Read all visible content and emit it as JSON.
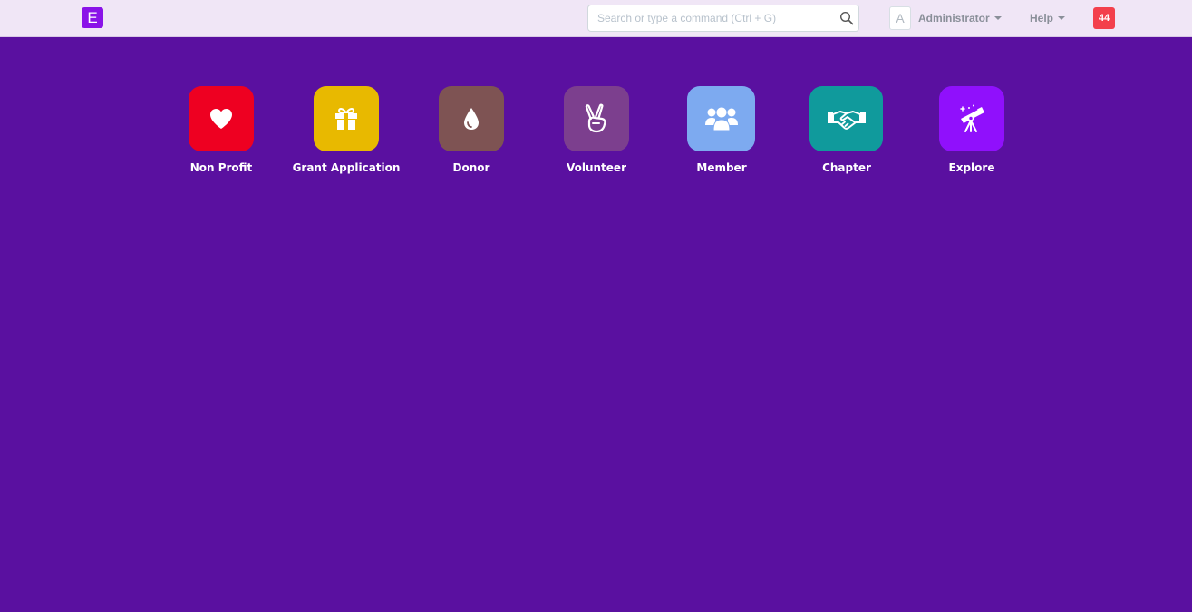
{
  "navbar": {
    "brand_letter": "E",
    "brand_color": "#8a12e8",
    "search_placeholder": "Search or type a command (Ctrl + G)",
    "avatar_letter": "A",
    "user_label": "Administrator",
    "help_label": "Help",
    "notification_count": "44",
    "notification_color": "#f3404c"
  },
  "background_color": "#5a10a0",
  "modules": [
    {
      "label": "Non Profit",
      "color": "#ee0021",
      "icon": "heart-icon"
    },
    {
      "label": "Grant Application",
      "color": "#e8b900",
      "icon": "gift-icon"
    },
    {
      "label": "Donor",
      "color": "#7e5353",
      "icon": "drop-icon"
    },
    {
      "label": "Volunteer",
      "color": "#7c3f8e",
      "icon": "victory-hand-icon"
    },
    {
      "label": "Member",
      "color": "#7daaf0",
      "icon": "users-icon"
    },
    {
      "label": "Chapter",
      "color": "#109a9c",
      "icon": "handshake-icon"
    },
    {
      "label": "Explore",
      "color": "#9010fc",
      "icon": "telescope-icon"
    }
  ]
}
